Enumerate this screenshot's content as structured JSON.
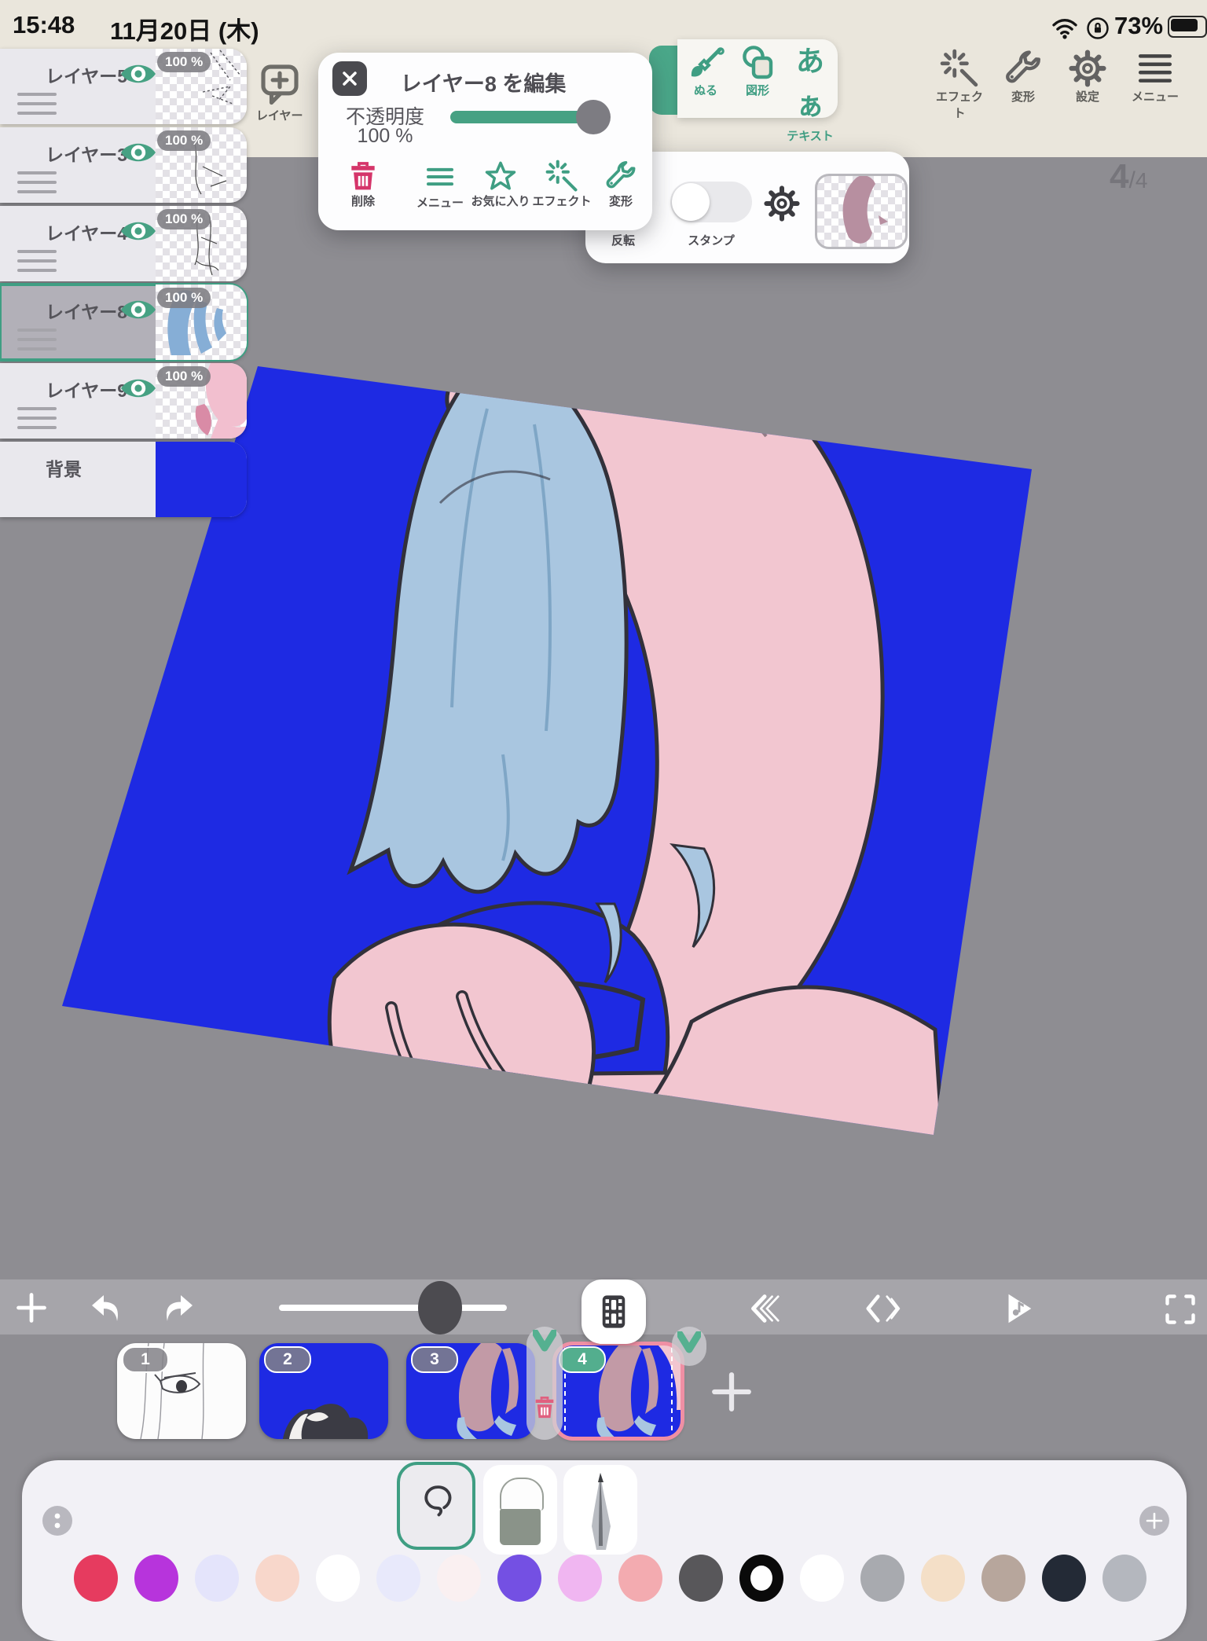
{
  "status_bar": {
    "time": "15:48",
    "date": "11月20日 (木)",
    "battery_percent": "73%"
  },
  "top_toolbar": {
    "add_layer_label": "レイヤー",
    "paint_label": "ぬる",
    "shape_label": "図形",
    "text_glyph": "あぁ",
    "text_label": "テキスト",
    "effect_label": "エフェクト",
    "transform_label": "変形",
    "settings_label": "設定",
    "menu_label": "メニュー"
  },
  "edit_layer_popup": {
    "title": "レイヤー8 を編集",
    "opacity_label": "不透明度",
    "opacity_value": "100 %",
    "delete_label": "削除",
    "menu_label": "メニュー",
    "favorite_label": "お気に入り",
    "effect_label": "エフェクト",
    "transform_label": "変形"
  },
  "stamp_popup": {
    "flip_label": "反転",
    "stamp_label": "スタンプ"
  },
  "page_indicator": {
    "current": "4",
    "separator": "/",
    "total": "4"
  },
  "layers_panel": {
    "items": [
      {
        "name": "レイヤー5",
        "opacity": "100 %"
      },
      {
        "name": "レイヤー3",
        "opacity": "100 %"
      },
      {
        "name": "レイヤー4",
        "opacity": "100 %"
      },
      {
        "name": "レイヤー8",
        "opacity": "100 %"
      },
      {
        "name": "レイヤー9",
        "opacity": "100 %"
      },
      {
        "name": "背景"
      }
    ],
    "selected_layer": "レイヤー8"
  },
  "timeline": {
    "frames": [
      {
        "number": "1"
      },
      {
        "number": "2"
      },
      {
        "number": "3"
      },
      {
        "number": "4"
      }
    ],
    "selected_frame": "4"
  },
  "palette": {
    "colors": [
      "#e63b5f",
      "#b734dc",
      "#e4e4fb",
      "#f8d7cb",
      "#ffffff",
      "#e8e9fb",
      "#faf0f1",
      "#7450e3",
      "#f0b6f1",
      "#f3abb0",
      "#58575a",
      "#0a0a0a",
      "#ffffff",
      "#a8aaaf",
      "#f4dfc7",
      "#b7a69c",
      "#232a36",
      "#b4b7be"
    ]
  },
  "colors": {
    "accent_teal": "#3f9e83",
    "delete_pink": "#d5356a",
    "canvas_blue": "#1e2ae3",
    "hood_pink": "#f2c6d0",
    "hair_blue": "#a9c6e0",
    "selection_pink": "#ef8fa4",
    "badge_teal": "#53ae8e"
  }
}
